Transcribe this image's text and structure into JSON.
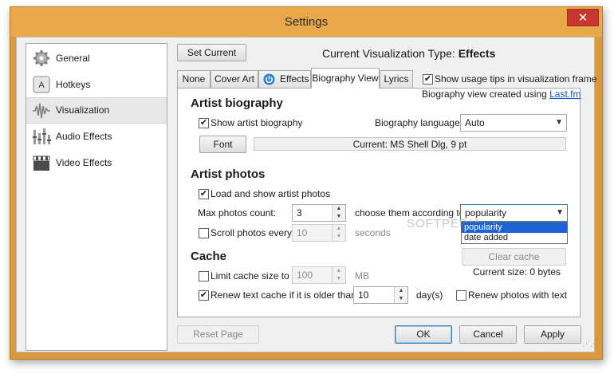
{
  "window": {
    "title": "Settings"
  },
  "sidebar": {
    "items": [
      {
        "label": "General",
        "icon": "gear-icon"
      },
      {
        "label": "Hotkeys",
        "icon": "keyboard-key-icon",
        "key_glyph": "A"
      },
      {
        "label": "Visualization",
        "icon": "waveform-icon",
        "selected": true
      },
      {
        "label": "Audio Effects",
        "icon": "equalizer-icon"
      },
      {
        "label": "Video Effects",
        "icon": "clapperboard-icon"
      }
    ]
  },
  "header": {
    "set_current_label": "Set Current",
    "vis_type_label": "Current Visualization Type:",
    "vis_type_value": "Effects"
  },
  "tabs": [
    {
      "label": "None"
    },
    {
      "label": "Cover Art"
    },
    {
      "label": "Effects",
      "icon": "power-icon"
    },
    {
      "label": "Biography View",
      "active": true
    },
    {
      "label": "Lyrics"
    }
  ],
  "usage_tips": {
    "label": "Show usage tips in visualization frame",
    "checked": true
  },
  "lastfm": {
    "prefix": "Biography view created using",
    "link": "Last.fm"
  },
  "artist_bio": {
    "title": "Artist biography",
    "show_label": "Show artist biography",
    "show_checked": true,
    "language_label": "Biography language:",
    "language_value": "Auto",
    "font_button": "Font",
    "font_current": "Current: MS Shell Dlg, 9 pt"
  },
  "artist_photos": {
    "title": "Artist photos",
    "load_label": "Load and show artist photos",
    "load_checked": true,
    "max_label": "Max photos count:",
    "max_value": "3",
    "choose_label": "choose them according to",
    "choose_value": "popularity",
    "dropdown_options": [
      "popularity",
      "date added"
    ],
    "scroll_label": "Scroll photos every",
    "scroll_checked": false,
    "scroll_value": "10",
    "scroll_unit": "seconds"
  },
  "cache": {
    "title": "Cache",
    "limit_label": "Limit cache size to",
    "limit_checked": false,
    "limit_value": "100",
    "limit_unit": "MB",
    "clear_button": "Clear cache",
    "current_size": "Current size: 0 bytes",
    "renew_label": "Renew text cache if it is older than",
    "renew_checked": true,
    "renew_value": "10",
    "renew_unit": "day(s)",
    "renew_photos_label": "Renew photos with text",
    "renew_photos_checked": false
  },
  "footer": {
    "reset_label": "Reset Page",
    "ok_label": "OK",
    "cancel_label": "Cancel",
    "apply_label": "Apply"
  },
  "watermark": "SOFTPEDIA",
  "colors": {
    "title_bar": "#e9a94b",
    "close_button": "#c7372f",
    "link": "#0b57c7",
    "dropdown_highlight": "#1e63d6"
  }
}
